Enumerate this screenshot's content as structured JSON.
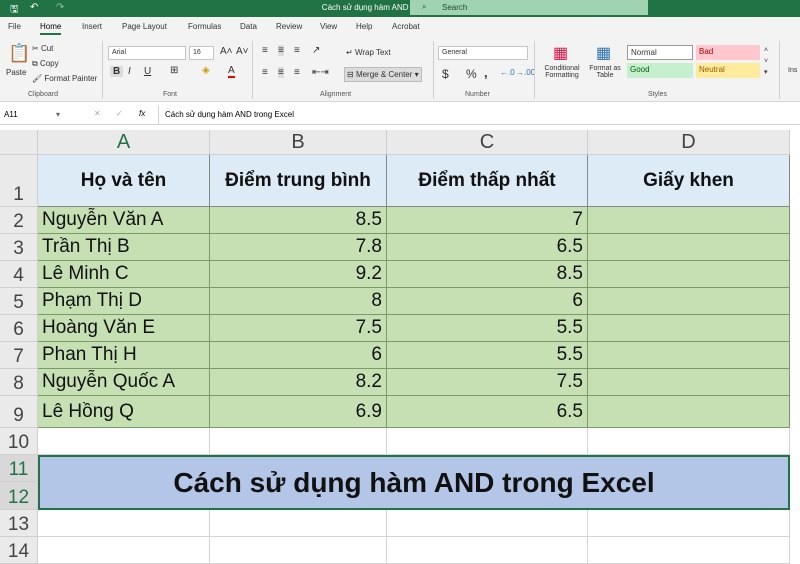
{
  "window": {
    "title": "Cách sử dụng hàm AND - FPT Shop  -  Excel",
    "search_placeholder": "Search"
  },
  "tabs": [
    "File",
    "Home",
    "Insert",
    "Page Layout",
    "Formulas",
    "Data",
    "Review",
    "View",
    "Help",
    "Acrobat"
  ],
  "ribbon": {
    "clipboard": {
      "paste": "Paste",
      "cut": "Cut",
      "copy": "Copy",
      "format_painter": "Format Painter",
      "label": "Clipboard"
    },
    "font": {
      "name": "Arial",
      "size": "16",
      "label": "Font",
      "bold": "B",
      "italic": "I",
      "underline": "U"
    },
    "alignment": {
      "wrap_text": "Wrap Text",
      "merge_center": "Merge & Center",
      "label": "Alignment"
    },
    "number": {
      "format": "General",
      "currency": "$",
      "percent": "%",
      "comma": ",",
      "label": "Number"
    },
    "styles": {
      "conditional": "Conditional Formatting",
      "format_table": "Format as Table",
      "normal": "Normal",
      "bad": "Bad",
      "good": "Good",
      "neutral": "Neutral",
      "label": "Styles"
    },
    "insert": "Ins"
  },
  "formula_bar": {
    "name_box": "A11",
    "fx": "fx",
    "content": "Cách sử dụng hàm AND trong Excel"
  },
  "sheet": {
    "columns": [
      "A",
      "B",
      "C",
      "D"
    ],
    "row_numbers": [
      "1",
      "2",
      "3",
      "4",
      "5",
      "6",
      "7",
      "8",
      "9",
      "10",
      "11",
      "12",
      "13",
      "14"
    ],
    "headers": [
      "Họ và tên",
      "Điểm trung bình",
      "Điểm thấp nhất",
      "Giấy khen"
    ],
    "rows": [
      [
        "Nguyễn Văn A",
        "8.5",
        "7",
        ""
      ],
      [
        "Trần Thị B",
        "7.8",
        "6.5",
        ""
      ],
      [
        "Lê Minh C",
        "9.2",
        "8.5",
        ""
      ],
      [
        "Phạm Thị D",
        "8",
        "6",
        ""
      ],
      [
        "Hoàng Văn E",
        "7.5",
        "5.5",
        ""
      ],
      [
        "Phan Thị H",
        "6",
        "5.5",
        ""
      ],
      [
        "Nguyễn Quốc A",
        "8.2",
        "7.5",
        ""
      ],
      [
        "Lê Hồng Q",
        "6.9",
        "6.5",
        ""
      ]
    ],
    "banner": "Cách sử dụng hàm AND trong Excel",
    "colors": {
      "header_fill": "#ddebf7",
      "data_fill": "#c6e0b4",
      "banner_fill": "#b4c6e7",
      "accent": "#217346"
    }
  }
}
